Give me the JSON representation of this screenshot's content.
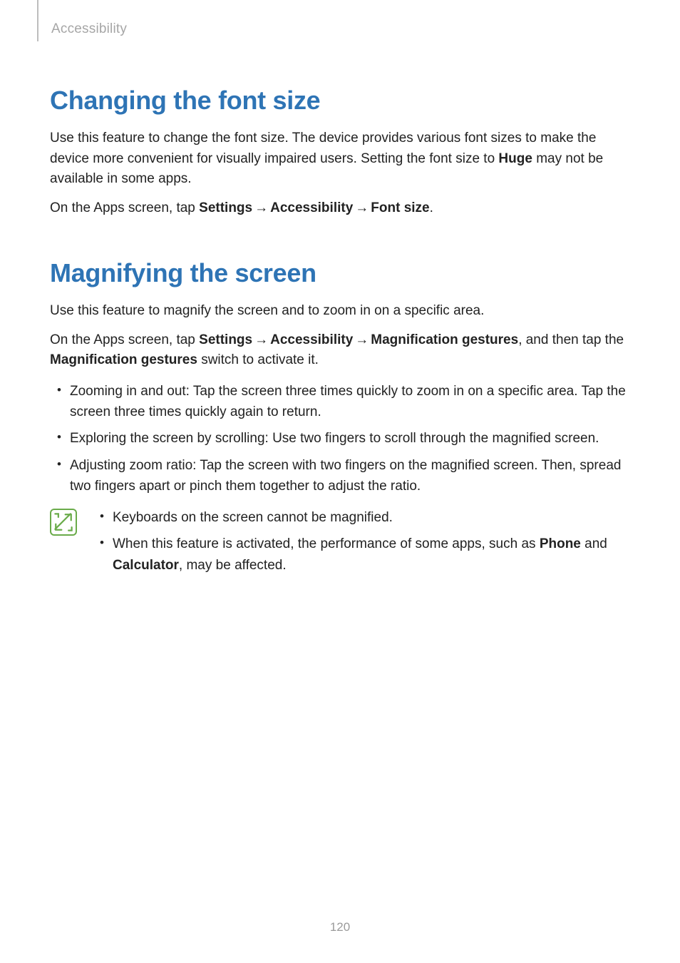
{
  "header": {
    "breadcrumb": "Accessibility"
  },
  "section1": {
    "title": "Changing the font size",
    "p1_a": "Use this feature to change the font size. The device provides various font sizes to make the device more convenient for visually impaired users. Setting the font size to ",
    "p1_bold": "Huge",
    "p1_b": " may not be available in some apps.",
    "p2_a": "On the Apps screen, tap ",
    "p2_nav1": "Settings",
    "p2_nav2": "Accessibility",
    "p2_nav3": "Font size",
    "p2_b": "."
  },
  "section2": {
    "title": "Magnifying the screen",
    "p1": "Use this feature to magnify the screen and to zoom in on a specific area.",
    "p2_a": "On the Apps screen, tap ",
    "p2_nav1": "Settings",
    "p2_nav2": "Accessibility",
    "p2_nav3": "Magnification gestures",
    "p2_b": ", and then tap the ",
    "p2_bold": "Magnification gestures",
    "p2_c": " switch to activate it.",
    "li1": "Zooming in and out: Tap the screen three times quickly to zoom in on a specific area. Tap the screen three times quickly again to return.",
    "li2": "Exploring the screen by scrolling: Use two fingers to scroll through the magnified screen.",
    "li3": "Adjusting zoom ratio: Tap the screen with two fingers on the magnified screen. Then, spread two fingers apart or pinch them together to adjust the ratio.",
    "note1": "Keyboards on the screen cannot be magnified.",
    "note2_a": "When this feature is activated, the performance of some apps, such as ",
    "note2_b1": "Phone",
    "note2_b": " and ",
    "note2_b2": "Calculator",
    "note2_c": ", may be affected."
  },
  "arrow": "→",
  "page_number": "120"
}
